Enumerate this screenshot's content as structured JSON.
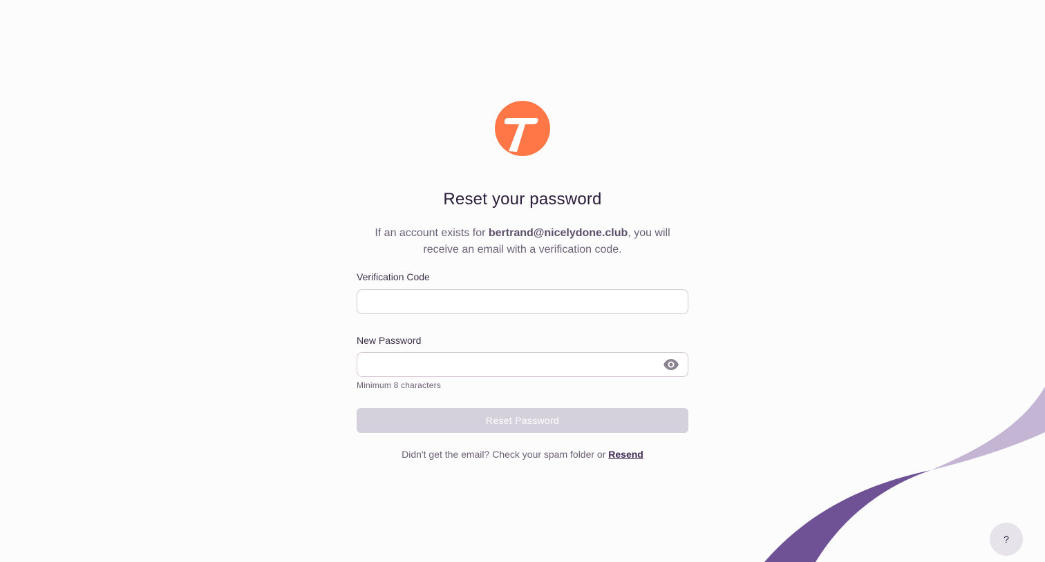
{
  "brand": {
    "logo_icon": "brand-t-logo-icon",
    "accent_color": "#ff7647"
  },
  "heading": {
    "title": "Reset your password"
  },
  "description": {
    "prefix": "If an account exists for ",
    "email": "bertrand@nicelydone.club",
    "suffix": ", you will receive an email with a verification code."
  },
  "form": {
    "verification_code": {
      "label": "Verification Code",
      "value": "",
      "placeholder": ""
    },
    "new_password": {
      "label": "New Password",
      "value": "",
      "placeholder": "",
      "hint": "Minimum 8 characters",
      "toggle_icon": "eye-icon"
    },
    "submit_label": "Reset Password"
  },
  "footer": {
    "text": "Didn't get the email? Check your spam folder or ",
    "resend_label": "Resend"
  },
  "help": {
    "label": "?"
  },
  "colors": {
    "ribbon_dark": "#6f5296",
    "ribbon_light": "#c3b5d3",
    "button_disabled": "#d4d1dc"
  }
}
